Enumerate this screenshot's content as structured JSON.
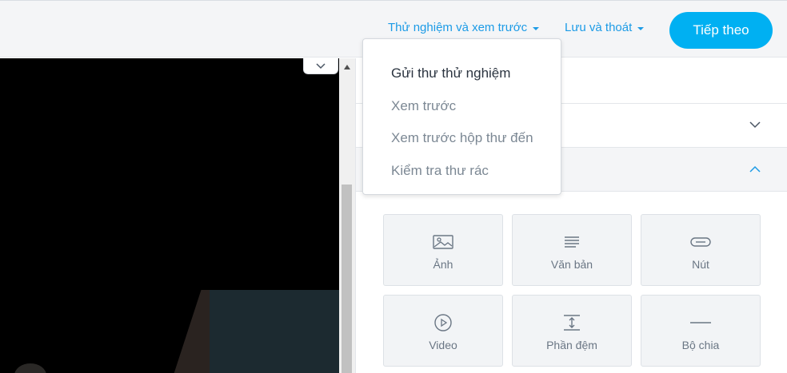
{
  "header": {
    "test_menu_label": "Thử nghiệm và xem trước",
    "save_menu_label": "Lưu và thoát",
    "next_button_label": "Tiếp theo"
  },
  "dropdown": {
    "items": [
      {
        "label": "Gửi thư thử nghiệm",
        "active": true
      },
      {
        "label": "Xem trước",
        "active": false
      },
      {
        "label": "Xem trước hộp thư đến",
        "active": false
      },
      {
        "label": "Kiểm tra thư rác",
        "active": false
      }
    ]
  },
  "blocks": {
    "items": [
      {
        "label": "Ảnh",
        "icon": "image-icon"
      },
      {
        "label": "Văn bản",
        "icon": "text-icon"
      },
      {
        "label": "Nút",
        "icon": "button-icon"
      },
      {
        "label": "Video",
        "icon": "play-icon"
      },
      {
        "label": "Phần đệm",
        "icon": "spacer-icon"
      },
      {
        "label": "Bộ chia",
        "icon": "divider-icon"
      }
    ]
  },
  "colors": {
    "accent": "#1c9be6",
    "button": "#00b0f2",
    "tile_bg": "#f2f4f6"
  }
}
